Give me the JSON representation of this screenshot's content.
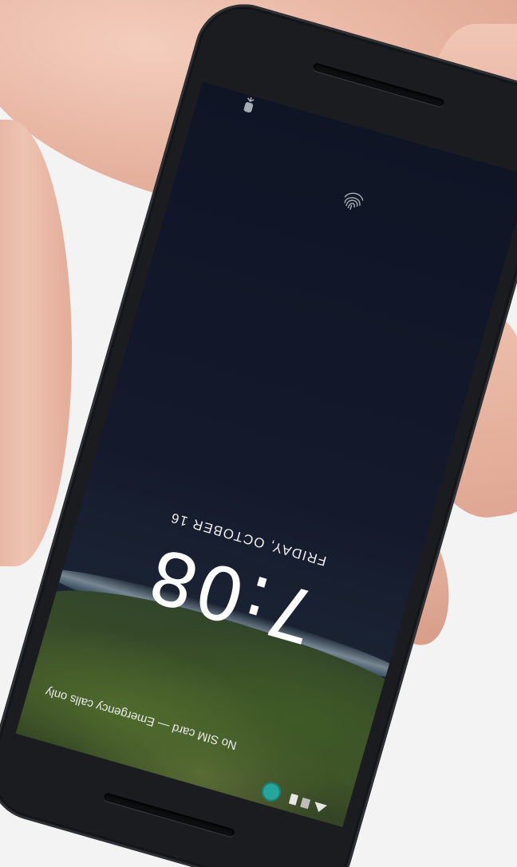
{
  "lock_screen": {
    "time": "7:08",
    "date": "FRIDAY, OCTOBER 16",
    "status_text": "No SIM card — Emergency calls only"
  },
  "icons": {
    "top_left": "phone-icon",
    "fingerprint": "fingerprint-icon",
    "status": [
      "wifi-icon",
      "cell-signal-icon",
      "battery-icon",
      "user-avatar-icon"
    ]
  },
  "colors": {
    "background": "#f3f3f3",
    "device_frame": "#1a1c20",
    "screen_dark": "#0f1525",
    "land_green": "#3e5128",
    "text": "#ffffff",
    "accent_avatar": "#26a69a"
  }
}
